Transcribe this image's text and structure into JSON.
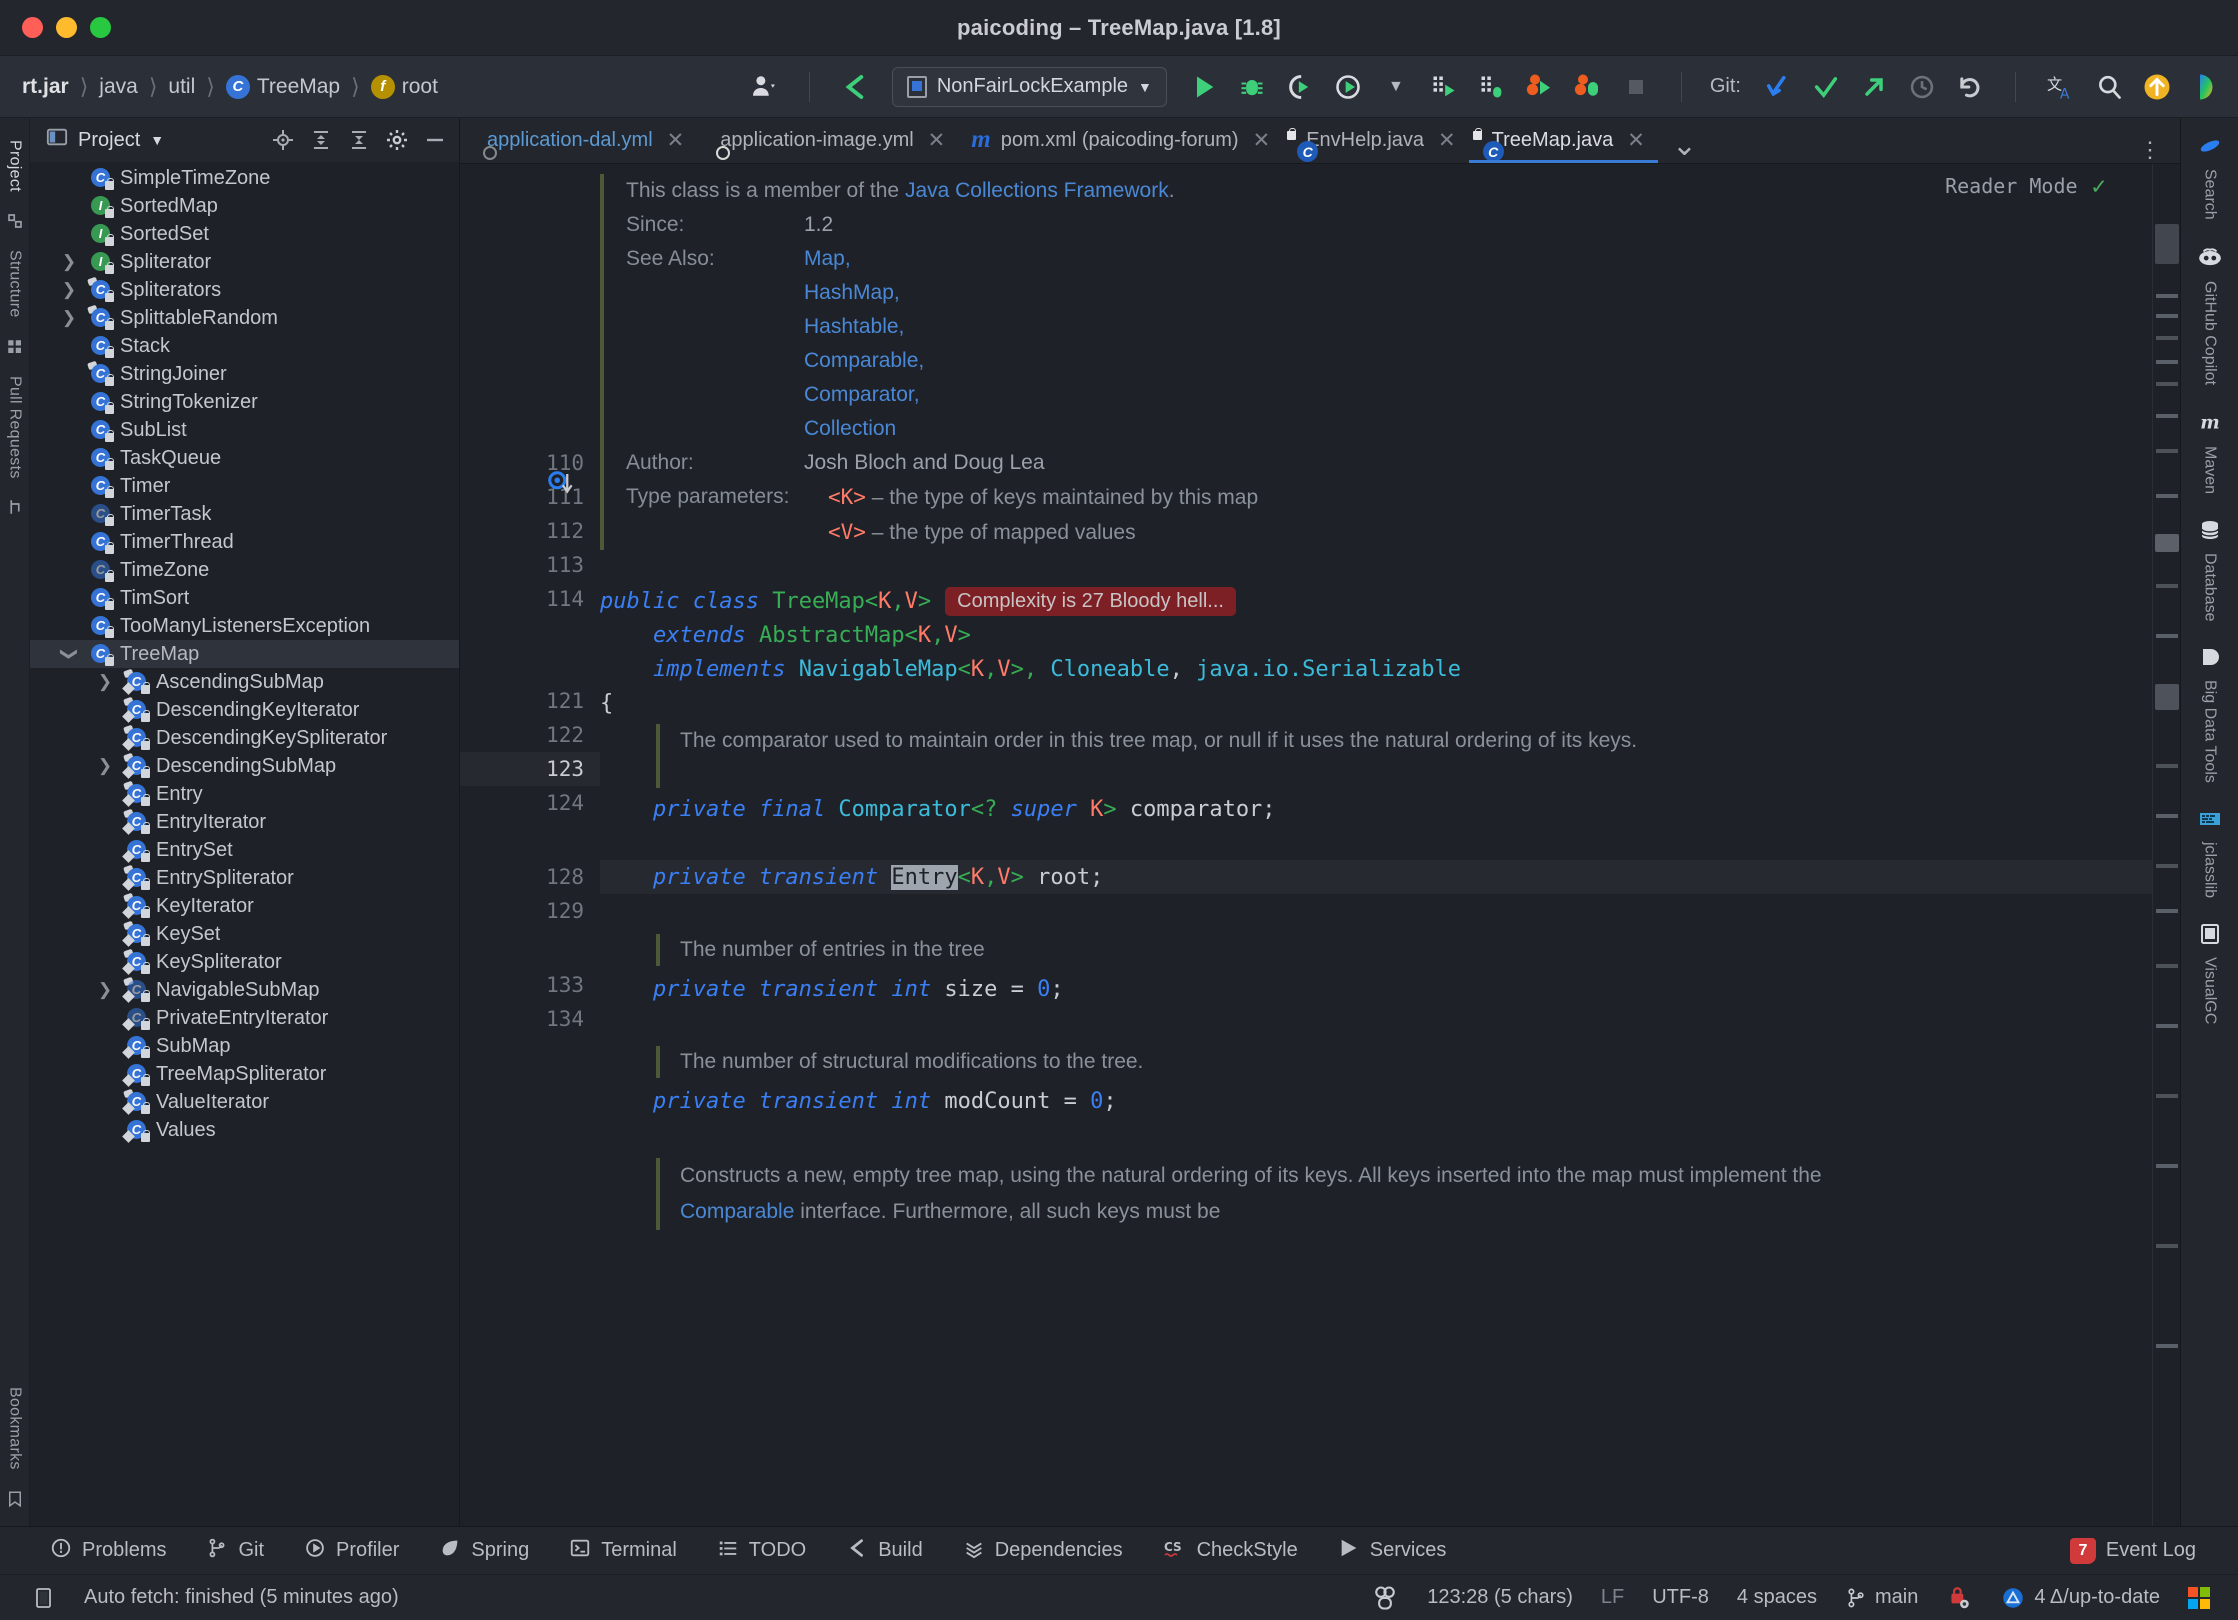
{
  "window": {
    "title": "paicoding – TreeMap.java [1.8]"
  },
  "navbar": {
    "breadcrumb": [
      {
        "label": "rt.jar",
        "icon": null,
        "bold": true
      },
      {
        "label": "java",
        "icon": null,
        "bold": false
      },
      {
        "label": "util",
        "icon": null,
        "bold": false
      },
      {
        "label": "TreeMap",
        "icon": "class-badge",
        "bold": false
      },
      {
        "label": "root",
        "icon": "field-badge",
        "bold": false
      }
    ],
    "run_configuration": "NonFairLockExample",
    "git_label": "Git:",
    "icons": [
      "user-avatar-icon",
      "vcs-branch-icon",
      "run-icon",
      "debug-icon",
      "run-with-coverage-icon",
      "profiler-icon",
      "build-icon",
      "build-debug-icon",
      "run-tests-icon",
      "debug-tests-icon",
      "stop-icon",
      "git-update-icon",
      "git-commit-icon",
      "git-push-icon",
      "git-history-icon",
      "git-rollback-icon",
      "translate-icon",
      "search-icon",
      "updates-icon",
      "ai-assistant-icon"
    ]
  },
  "left_strip": {
    "tabs": [
      "Project",
      "Structure",
      "Pull Requests",
      "Bookmarks"
    ],
    "selected": "Project"
  },
  "project_panel": {
    "title": "Project",
    "actions": [
      "locate-icon",
      "expand-all-icon",
      "collapse-all-icon",
      "settings-icon",
      "hide-icon"
    ],
    "tree": [
      {
        "label": "SimpleTimeZone",
        "indent": 1,
        "arrow": "",
        "kind": "class",
        "partial": true
      },
      {
        "label": "SortedMap",
        "indent": 1,
        "arrow": "",
        "kind": "interface"
      },
      {
        "label": "SortedSet",
        "indent": 1,
        "arrow": "",
        "kind": "interface"
      },
      {
        "label": "Spliterator",
        "indent": 1,
        "arrow": "right",
        "kind": "interface"
      },
      {
        "label": "Spliterators",
        "indent": 1,
        "arrow": "right",
        "kind": "abstract-class"
      },
      {
        "label": "SplittableRandom",
        "indent": 1,
        "arrow": "right",
        "kind": "abstract-class"
      },
      {
        "label": "Stack",
        "indent": 1,
        "arrow": "",
        "kind": "class"
      },
      {
        "label": "StringJoiner",
        "indent": 1,
        "arrow": "",
        "kind": "abstract-class"
      },
      {
        "label": "StringTokenizer",
        "indent": 1,
        "arrow": "",
        "kind": "class"
      },
      {
        "label": "SubList",
        "indent": 1,
        "arrow": "",
        "kind": "class"
      },
      {
        "label": "TaskQueue",
        "indent": 1,
        "arrow": "",
        "kind": "class"
      },
      {
        "label": "Timer",
        "indent": 1,
        "arrow": "",
        "kind": "class"
      },
      {
        "label": "TimerTask",
        "indent": 1,
        "arrow": "",
        "kind": "class-faded"
      },
      {
        "label": "TimerThread",
        "indent": 1,
        "arrow": "",
        "kind": "class"
      },
      {
        "label": "TimeZone",
        "indent": 1,
        "arrow": "",
        "kind": "class-faded"
      },
      {
        "label": "TimSort",
        "indent": 1,
        "arrow": "",
        "kind": "class"
      },
      {
        "label": "TooManyListenersException",
        "indent": 1,
        "arrow": "",
        "kind": "class"
      },
      {
        "label": "TreeMap",
        "indent": 1,
        "arrow": "down",
        "kind": "class",
        "selected": true
      },
      {
        "label": "AscendingSubMap",
        "indent": 2,
        "arrow": "right",
        "kind": "inner-abstract-class"
      },
      {
        "label": "DescendingKeyIterator",
        "indent": 2,
        "arrow": "",
        "kind": "inner-abstract-class"
      },
      {
        "label": "DescendingKeySpliterator",
        "indent": 2,
        "arrow": "",
        "kind": "inner-abstract-class"
      },
      {
        "label": "DescendingSubMap",
        "indent": 2,
        "arrow": "right",
        "kind": "inner-abstract-class"
      },
      {
        "label": "Entry",
        "indent": 2,
        "arrow": "",
        "kind": "inner-abstract-class"
      },
      {
        "label": "EntryIterator",
        "indent": 2,
        "arrow": "",
        "kind": "inner-abstract-class"
      },
      {
        "label": "EntrySet",
        "indent": 2,
        "arrow": "",
        "kind": "inner-class"
      },
      {
        "label": "EntrySpliterator",
        "indent": 2,
        "arrow": "",
        "kind": "inner-abstract-class"
      },
      {
        "label": "KeyIterator",
        "indent": 2,
        "arrow": "",
        "kind": "inner-abstract-class"
      },
      {
        "label": "KeySet",
        "indent": 2,
        "arrow": "",
        "kind": "inner-abstract-class"
      },
      {
        "label": "KeySpliterator",
        "indent": 2,
        "arrow": "",
        "kind": "inner-abstract-class"
      },
      {
        "label": "NavigableSubMap",
        "indent": 2,
        "arrow": "right",
        "kind": "inner-abstract-faded"
      },
      {
        "label": "PrivateEntryIterator",
        "indent": 2,
        "arrow": "",
        "kind": "inner-class-faded"
      },
      {
        "label": "SubMap",
        "indent": 2,
        "arrow": "",
        "kind": "inner-class"
      },
      {
        "label": "TreeMapSpliterator",
        "indent": 2,
        "arrow": "",
        "kind": "inner-diamond-class"
      },
      {
        "label": "ValueIterator",
        "indent": 2,
        "arrow": "",
        "kind": "inner-abstract-class"
      },
      {
        "label": "Values",
        "indent": 2,
        "arrow": "",
        "kind": "inner-class"
      }
    ]
  },
  "editor_tabs": [
    {
      "label": "application-dal.yml",
      "icon": "yaml-icon",
      "active": false,
      "muted": true
    },
    {
      "label": "application-image.yml",
      "icon": "yaml-icon",
      "active": false
    },
    {
      "label": "pom.xml (paicoding-forum)",
      "icon": "maven-icon",
      "active": false
    },
    {
      "label": "EnvHelp.java",
      "icon": "java-class-readonly-icon",
      "active": false
    },
    {
      "label": "TreeMap.java",
      "icon": "java-class-readonly-icon",
      "active": true
    }
  ],
  "editor": {
    "reader_mode": "Reader Mode",
    "javadoc": {
      "intro_prefix": "This class is a member of the ",
      "intro_link": "Java Collections Framework",
      "intro_suffix": ".",
      "since_label": "Since:",
      "since_value": "1.2",
      "see_also_label": "See Also:",
      "see_also": [
        "Map,",
        "HashMap,",
        "Hashtable,",
        "Comparable,",
        "Comparator,",
        "Collection"
      ],
      "author_label": "Author:",
      "author_value": "Josh Bloch and Doug Lea",
      "type_params_label": "Type parameters:",
      "type_params": [
        {
          "name": "<K>",
          "desc": " – the type of keys maintained by this map"
        },
        {
          "name": "<V>",
          "desc": " – the type of mapped values"
        }
      ]
    },
    "complexity_badge": "Complexity is 27 Bloody hell...",
    "lines": [
      {
        "num": "110",
        "segments": []
      },
      {
        "num": "111",
        "gutter_icon": "implemented-method-icon",
        "segments": [
          {
            "t": "public ",
            "c": "kw"
          },
          {
            "t": "class ",
            "c": "kw"
          },
          {
            "t": "TreeMap",
            "c": "typ"
          },
          {
            "t": "<",
            "c": "typ"
          },
          {
            "t": "K",
            "c": "gen"
          },
          {
            "t": ",",
            "c": "typ"
          },
          {
            "t": "V",
            "c": "gen"
          },
          {
            "t": ">",
            "c": "typ"
          }
        ],
        "badge": true
      },
      {
        "num": "112",
        "indent": 2,
        "segments": [
          {
            "t": "extends ",
            "c": "kw"
          },
          {
            "t": "AbstractMap",
            "c": "typ"
          },
          {
            "t": "<",
            "c": "typ"
          },
          {
            "t": "K",
            "c": "gen"
          },
          {
            "t": ",",
            "c": "typ"
          },
          {
            "t": "V",
            "c": "gen"
          },
          {
            "t": ">",
            "c": "typ"
          }
        ]
      },
      {
        "num": "113",
        "indent": 2,
        "segments": [
          {
            "t": "implements ",
            "c": "kw"
          },
          {
            "t": "NavigableMap",
            "c": "cyan"
          },
          {
            "t": "<",
            "c": "typ"
          },
          {
            "t": "K",
            "c": "gen"
          },
          {
            "t": ",",
            "c": "typ"
          },
          {
            "t": "V",
            "c": "gen"
          },
          {
            "t": ">, ",
            "c": "typ"
          },
          {
            "t": "Cloneable",
            "c": "cyan"
          },
          {
            "t": ", ",
            "c": "plain"
          },
          {
            "t": "java.io.Serializable",
            "c": "cyan"
          }
        ]
      },
      {
        "num": "114",
        "segments": [
          {
            "t": "{",
            "c": "plain"
          }
        ]
      }
    ],
    "comment1": "The comparator used to maintain order in this tree map, or null if it uses the natural ordering of its keys.",
    "line121": {
      "num": "121",
      "code": "private final Comparator<? super K> comparator;"
    },
    "line122": {
      "num": "122"
    },
    "line123": {
      "num": "123",
      "pre": "private transient ",
      "selected_token": "Entry",
      "post": "<K,V> root;"
    },
    "line124": {
      "num": "124"
    },
    "comment2": "The number of entries in the tree",
    "line128": {
      "num": "128",
      "code": "private transient int size = 0;"
    },
    "line129": {
      "num": "129"
    },
    "comment3": "The number of structural modifications to the tree.",
    "line133": {
      "num": "133",
      "code": "private transient int modCount = 0;"
    },
    "line134": {
      "num": "134"
    },
    "comment4_a": "Constructs a new, empty tree map, using the natural ordering of its keys. All keys inserted into",
    "comment4_b_pre": "the map must implement the ",
    "comment4_b_link": "Comparable",
    "comment4_b_post": " interface. Furthermore, all such keys must be"
  },
  "right_strip": {
    "tabs": [
      {
        "label": "Search",
        "icon": "search-icon"
      },
      {
        "label": "GitHub Copilot",
        "icon": "copilot-icon"
      },
      {
        "label": "Maven",
        "icon": "maven-icon"
      },
      {
        "label": "Database",
        "icon": "database-icon"
      },
      {
        "label": "Big Data Tools",
        "icon": "big-data-icon"
      },
      {
        "label": "jclasslib",
        "icon": "jclasslib-icon"
      },
      {
        "label": "VisualGC",
        "icon": "visualgc-icon"
      }
    ]
  },
  "bottom_toolwindows": [
    {
      "label": "Problems",
      "icon": "problems-icon"
    },
    {
      "label": "Git",
      "icon": "git-icon"
    },
    {
      "label": "Profiler",
      "icon": "profiler-icon"
    },
    {
      "label": "Spring",
      "icon": "spring-leaf-icon"
    },
    {
      "label": "Terminal",
      "icon": "terminal-icon"
    },
    {
      "label": "TODO",
      "icon": "todo-icon"
    },
    {
      "label": "Build",
      "icon": "build-hammer-icon"
    },
    {
      "label": "Dependencies",
      "icon": "dependencies-icon"
    },
    {
      "label": "CheckStyle",
      "icon": "checkstyle-icon"
    },
    {
      "label": "Services",
      "icon": "services-icon"
    }
  ],
  "event_log": {
    "count": "7",
    "label": "Event Log"
  },
  "statusbar": {
    "message": "Auto fetch: finished (5 minutes ago)",
    "position": "123:28 (5 chars)",
    "line_separator": "LF",
    "encoding": "UTF-8",
    "indent": "4 spaces",
    "branch": "main",
    "sync": "4 Δ/up-to-date"
  },
  "colors": {
    "accent_blue": "#3573d6",
    "keyword_blue": "#3b7ff5",
    "type_green": "#37ad55",
    "generic_orange": "#ff7b68",
    "badge_red": "#7c2026",
    "link_blue": "#4a88d6",
    "background": "#1e2228",
    "panel": "#23262d"
  }
}
